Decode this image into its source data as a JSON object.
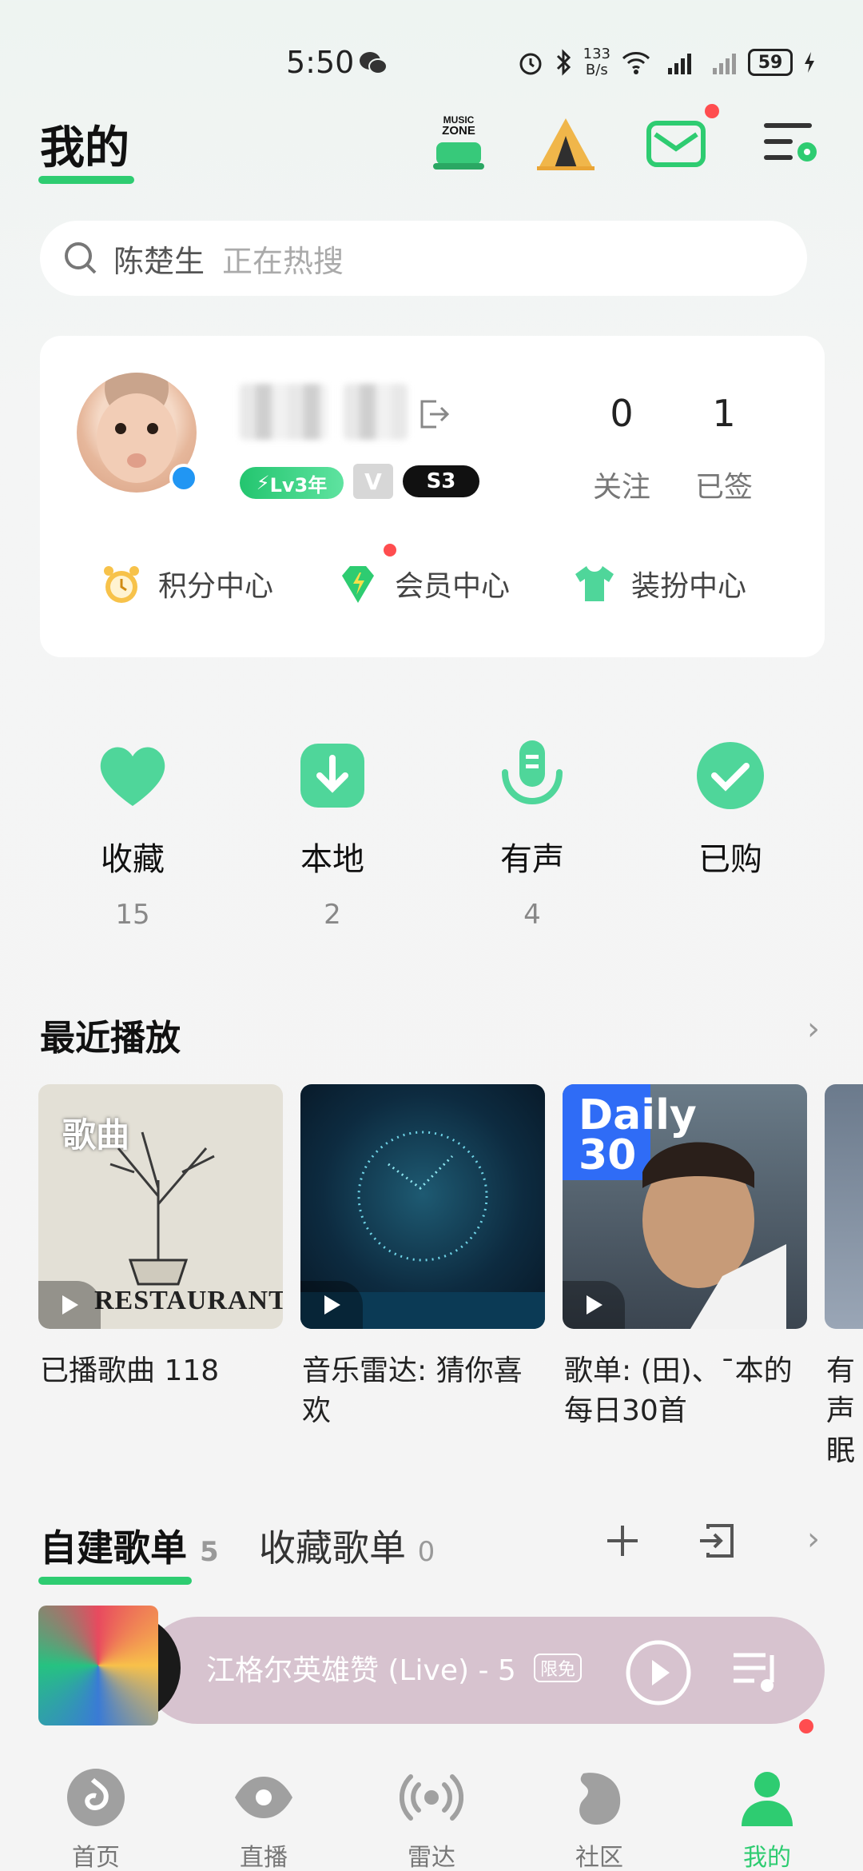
{
  "status_bar": {
    "time": "5:50",
    "net_speed_top": "133",
    "net_speed_bottom": "B/s",
    "battery": "59"
  },
  "header": {
    "title": "我的",
    "music_zone_top": "MUSIC",
    "music_zone_bottom": "ZONE"
  },
  "search": {
    "query": "陈楚生",
    "suffix": "正在热搜"
  },
  "profile": {
    "level_badge": "Lv3年",
    "s3_badge": "S3",
    "stats": [
      {
        "value": "0",
        "label": "关注"
      },
      {
        "value": "1",
        "label": "已签"
      }
    ],
    "centers": [
      {
        "label": "积分中心"
      },
      {
        "label": "会员中心"
      },
      {
        "label": "装扮中心"
      }
    ]
  },
  "quick_buttons": [
    {
      "label": "收藏",
      "count": "15"
    },
    {
      "label": "本地",
      "count": "2"
    },
    {
      "label": "有声",
      "count": "4"
    },
    {
      "label": "已购",
      "count": ""
    }
  ],
  "recent": {
    "title": "最近播放",
    "items": [
      {
        "cover_text": "歌曲",
        "cover_sub": "RESTAURANT",
        "caption": "已播歌曲 118"
      },
      {
        "cover_text": "",
        "cover_sub": "",
        "caption": "音乐雷达: 猜你喜欢"
      },
      {
        "cover_text": "Daily 30",
        "cover_sub": "",
        "caption": "歌单: (田)、¯本的每日30首"
      },
      {
        "cover_text": "",
        "cover_sub": "",
        "caption": "有声眠"
      }
    ]
  },
  "playlists": {
    "tab_created": "自建歌单",
    "tab_created_count": "5",
    "tab_collected": "收藏歌单",
    "tab_collected_count": "0"
  },
  "mini_player": {
    "title": "江格尔英雄赞 (Live) - 5",
    "tag": "限免"
  },
  "bottom_nav": [
    {
      "label": "首页"
    },
    {
      "label": "直播"
    },
    {
      "label": "雷达"
    },
    {
      "label": "社区"
    },
    {
      "label": "我的"
    }
  ],
  "colors": {
    "accent": "#2ecc71",
    "badge_red": "#ff4d4f",
    "mini_player_bg": "#d7c3cf"
  }
}
